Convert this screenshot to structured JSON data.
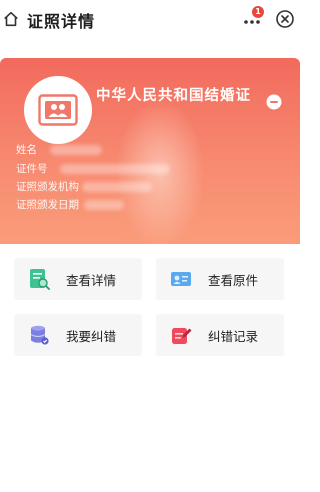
{
  "header": {
    "title": "证照详情",
    "badge_count": "1"
  },
  "card": {
    "cert_name": "中华人民共和国结婚证",
    "fields": [
      {
        "label": "姓名"
      },
      {
        "label": "证件号"
      },
      {
        "label": "证照颁发机构"
      },
      {
        "label": "证照颁发日期"
      }
    ]
  },
  "actions": [
    {
      "label": "查看详情",
      "icon": "file-search-icon",
      "color": "#3ec28f"
    },
    {
      "label": "查看原件",
      "icon": "id-card-icon",
      "color": "#5aa9ef"
    },
    {
      "label": "我要纠错",
      "icon": "database-icon",
      "color": "#7b7fe0"
    },
    {
      "label": "纠错记录",
      "icon": "edit-record-icon",
      "color": "#ef4a5e"
    }
  ],
  "colors": {
    "card_top": "#f26a5d",
    "card_bottom": "#fa9c7a",
    "badge": "#e9463d"
  }
}
